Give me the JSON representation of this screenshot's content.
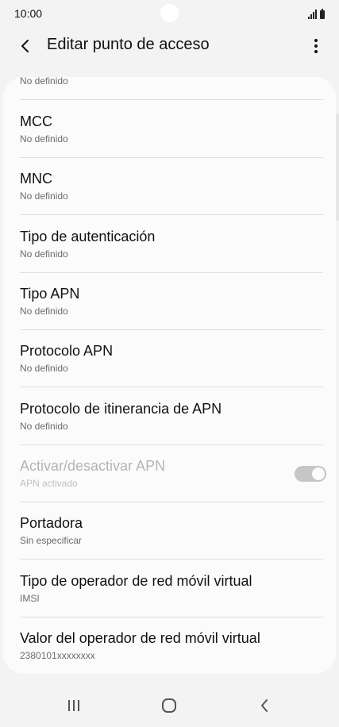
{
  "status_bar": {
    "time": "10:00",
    "signal_icon": "signal-icon",
    "battery_icon": "battery-icon"
  },
  "app_bar": {
    "title": "Editar punto de acceso",
    "back_icon": "chevron-left-icon",
    "more_icon": "more-vert-icon"
  },
  "list": {
    "partial_item_sub": "No definido",
    "items": [
      {
        "title": "MCC",
        "sub": "No definido"
      },
      {
        "title": "MNC",
        "sub": "No definido"
      },
      {
        "title": "Tipo de autenticación",
        "sub": "No definido"
      },
      {
        "title": "Tipo APN",
        "sub": "No definido"
      },
      {
        "title": "Protocolo APN",
        "sub": "No definido"
      },
      {
        "title": "Protocolo de itinerancia de APN",
        "sub": "No definido"
      },
      {
        "title": "Activar/desactivar APN",
        "sub": "APN activado",
        "toggle_on": true,
        "disabled": true
      },
      {
        "title": "Portadora",
        "sub": "Sin especificar"
      },
      {
        "title": "Tipo de operador de red móvil virtual",
        "sub": "IMSI"
      },
      {
        "title": "Valor del operador de red móvil virtual",
        "sub": "2380101xxxxxxxx"
      }
    ]
  },
  "nav_bar": {
    "recents_icon": "recents-icon",
    "home_icon": "home-icon",
    "back_icon": "back-chevron-icon"
  },
  "colors": {
    "background": "#f3f3f3",
    "card": "#fbfbfb",
    "divider": "#dfdfdf",
    "toggle_disabled": "#c6c6c6"
  }
}
